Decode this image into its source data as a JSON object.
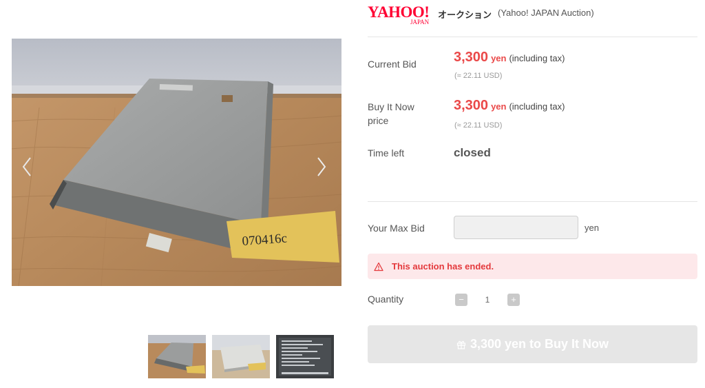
{
  "header": {
    "logo_word": "YAHOO!",
    "logo_sub": "JAPAN",
    "auction_jp": "オークション",
    "auction_en": "(Yahoo! JAPAN Auction)"
  },
  "gallery": {
    "photo_label_text": "070416c",
    "thumbnail_count": 3,
    "icons": {
      "prev": "chevron-left-icon",
      "next": "chevron-right-icon"
    }
  },
  "current_bid": {
    "label": "Current Bid",
    "amount": "3,300",
    "unit": "yen",
    "tax": "(including tax)",
    "usd": "(≈ 22.11 USD)"
  },
  "buy_now": {
    "label_line1": "Buy It Now",
    "label_line2": "price",
    "amount": "3,300",
    "unit": "yen",
    "tax": "(including tax)",
    "usd": "(≈ 22.11 USD)"
  },
  "time_left": {
    "label": "Time left",
    "value": "closed"
  },
  "max_bid": {
    "label": "Your Max Bid",
    "value": "",
    "unit": "yen"
  },
  "alert": {
    "icon": "warning-icon",
    "text": "This auction has ended."
  },
  "quantity": {
    "label": "Quantity",
    "minus": "−",
    "value": "1",
    "plus": "+"
  },
  "buy_button": {
    "icon": "gift-icon",
    "label": "3,300 yen to Buy It Now"
  },
  "colors": {
    "price_red": "#ea4848",
    "alert_bg": "#fde8ea",
    "alert_text": "#e4393c",
    "logo_red": "#ff0033",
    "disabled_button": "#e6e6e6"
  }
}
